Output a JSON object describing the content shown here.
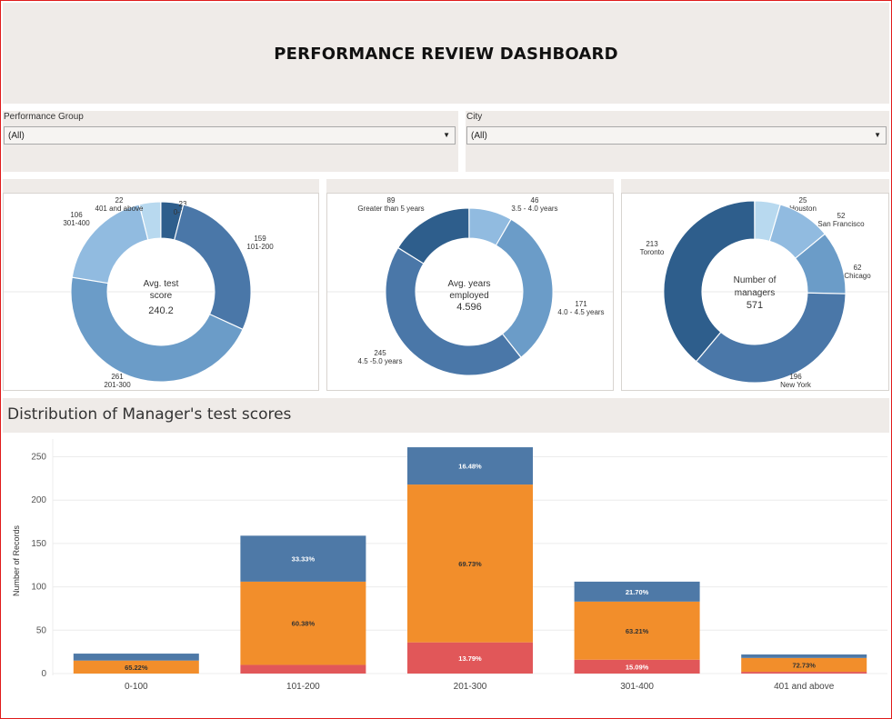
{
  "dashboard": {
    "title": "PERFORMANCE REVIEW DASHBOARD"
  },
  "filters": {
    "performance_group": {
      "label": "Performance Group",
      "value": "(All)"
    },
    "city": {
      "label": "City",
      "value": "(All)"
    }
  },
  "section": {
    "title": "Distribution of Manager's test scores"
  },
  "colors": {
    "dark_blue": "#2e5e8c",
    "mid_blue": "#4a77a8",
    "blue": "#6b9cc8",
    "light_blue": "#91bbe0",
    "pale_blue": "#b8d9ef",
    "orange": "#f28e2b",
    "red": "#e15759",
    "bar_blue": "#4e79a7"
  },
  "chart_data": [
    {
      "type": "pie",
      "center_text": [
        "Avg. test",
        "score",
        "240.2"
      ],
      "slices": [
        {
          "value": "23",
          "label": "0-100"
        },
        {
          "value": "159",
          "label": "101-200"
        },
        {
          "value": "261",
          "label": "201-300"
        },
        {
          "value": "106",
          "label": "301-400"
        },
        {
          "value": "22",
          "label": "401 and above"
        }
      ]
    },
    {
      "type": "pie",
      "center_text": [
        "Avg. years",
        "employed",
        "4.596"
      ],
      "slices": [
        {
          "value": "46",
          "label": "3.5 - 4.0 years"
        },
        {
          "value": "171",
          "label": "4.0 - 4.5 years"
        },
        {
          "value": "245",
          "label": "4.5 -5.0 years"
        },
        {
          "value": "89",
          "label": "Greater than 5 years"
        }
      ]
    },
    {
      "type": "pie",
      "center_text": [
        "Number of",
        "managers",
        "571"
      ],
      "slices": [
        {
          "value": "25",
          "label": "Houston"
        },
        {
          "value": "52",
          "label": "San Francisco"
        },
        {
          "value": "62",
          "label": "Chicago"
        },
        {
          "value": "196",
          "label": "New York"
        },
        {
          "value": "213",
          "label": "Toronto"
        }
      ]
    },
    {
      "type": "bar",
      "stacked": true,
      "title": "Distribution of Manager's test scores",
      "ylabel": "Number of Records",
      "ylim": [
        0,
        260
      ],
      "yticks": [
        "0",
        "50",
        "100",
        "150",
        "200",
        "250"
      ],
      "categories": [
        "0-100",
        "101-200",
        "201-300",
        "301-400",
        "401 and above"
      ],
      "series": [
        {
          "color": "#e15759",
          "values": [
            0,
            10,
            36,
            16,
            2
          ],
          "labels": [
            "",
            "",
            "13.79%",
            "15.09%",
            ""
          ]
        },
        {
          "color": "#f28e2b",
          "values": [
            15,
            96,
            182,
            67,
            16
          ],
          "labels": [
            "65.22%",
            "60.38%",
            "69.73%",
            "63.21%",
            "72.73%"
          ]
        },
        {
          "color": "#4e79a7",
          "values": [
            8,
            53,
            43,
            23,
            4
          ],
          "labels": [
            "",
            "33.33%",
            "16.48%",
            "21.70%",
            ""
          ]
        }
      ]
    }
  ]
}
